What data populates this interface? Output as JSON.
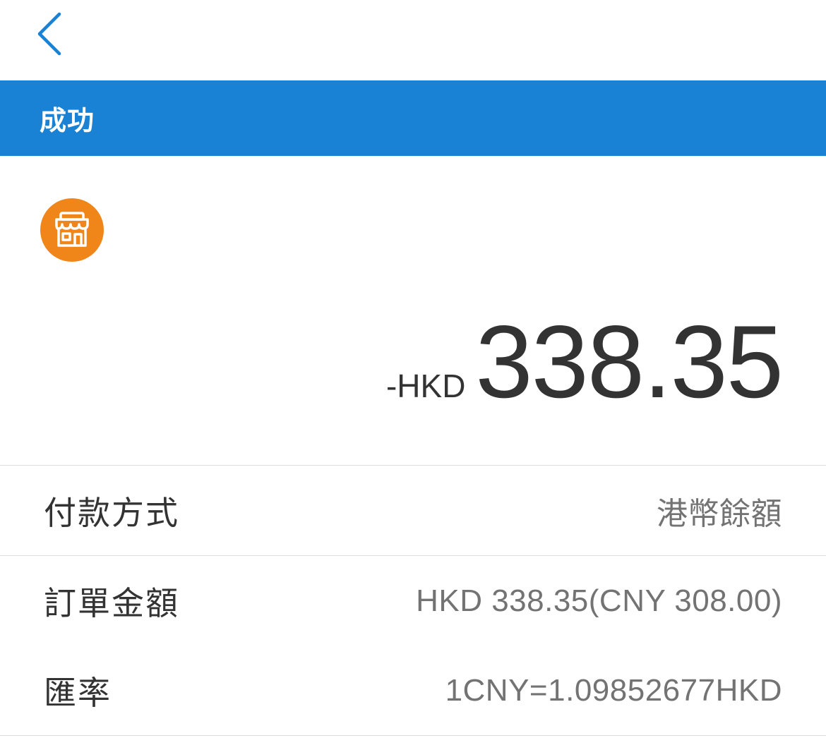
{
  "nav": {
    "back_icon": "chevron-left-icon"
  },
  "status": {
    "label": "成功"
  },
  "merchant": {
    "icon": "store-icon",
    "accent_color": "#f0861a"
  },
  "amount": {
    "prefix": "-HKD",
    "value": "338.35"
  },
  "details": {
    "payment_method": {
      "label": "付款方式",
      "value": "港幣餘額"
    },
    "order_amount": {
      "label": "訂單金額",
      "value": "HKD 338.35(CNY 308.00)"
    },
    "exchange_rate": {
      "label": "匯率",
      "value": "1CNY=1.09852677HKD"
    }
  },
  "colors": {
    "brand_blue": "#1a82d4",
    "merchant_orange": "#f0861a",
    "text_primary": "#333333",
    "text_secondary": "#737373"
  }
}
